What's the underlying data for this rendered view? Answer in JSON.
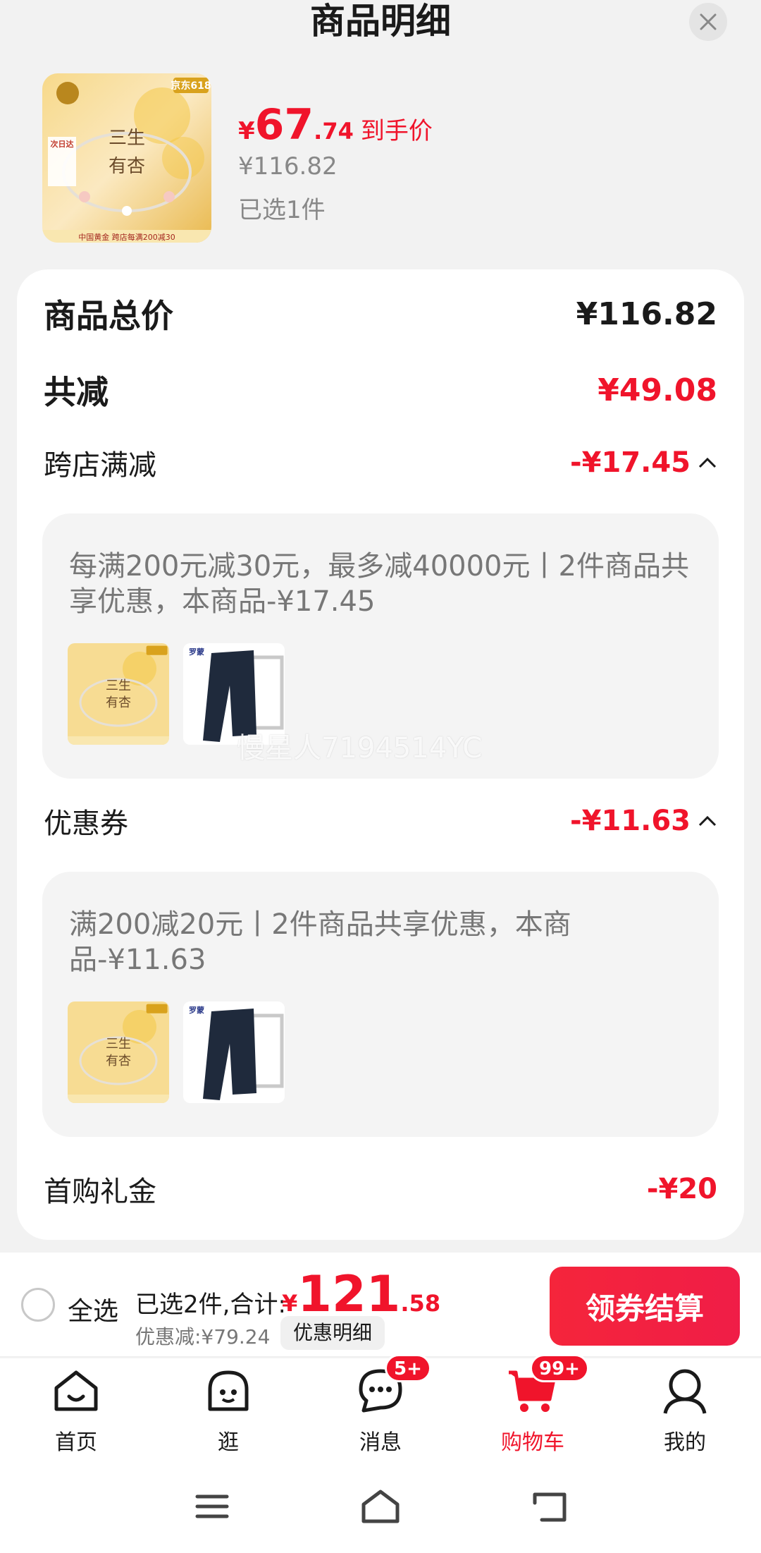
{
  "header": {
    "title": "商品明细"
  },
  "product": {
    "price_yen": "¥",
    "price_int": "67",
    "price_dec": ".74",
    "price_tag": "到手价",
    "original_price": "¥116.82",
    "selected": "已选1件",
    "thumb_text": {
      "brand": "京东618",
      "line1": "三生",
      "line2": "有杏",
      "footer": "中国黄金 跨店每满200减30",
      "tag": "次日达"
    }
  },
  "summary": {
    "total_label": "商品总价",
    "total_value": "¥116.82",
    "reduce_label": "共减",
    "reduce_value": "¥49.08"
  },
  "promotions": [
    {
      "label": "跨店满减",
      "amount": "-¥17.45",
      "detail": "每满200元减30元，最多减40000元丨2件商品共享优惠，本商品-¥17.45"
    },
    {
      "label": "优惠券",
      "amount": "-¥11.63",
      "detail": "满200减20元丨2件商品共享优惠，本商品-¥11.63"
    }
  ],
  "gift": {
    "label": "首购礼金",
    "amount": "-¥20"
  },
  "watermark": "慢星人7194514YC",
  "second_thumb_brand": "罗蒙",
  "checkout": {
    "select_all": "全选",
    "summary_text": "已选2件,合计:",
    "total_yen": "¥",
    "total_int": "121",
    "total_dec": ".58",
    "discount": "优惠减:¥79.24",
    "detail_chip": "优惠明细",
    "pay_button": "领券结算"
  },
  "tabs": [
    {
      "label": "首页",
      "icon": "home-icon"
    },
    {
      "label": "逛",
      "icon": "face-icon"
    },
    {
      "label": "消息",
      "icon": "chat-icon",
      "badge": "5+"
    },
    {
      "label": "购物车",
      "icon": "cart-icon",
      "badge": "99+",
      "active": true
    },
    {
      "label": "我的",
      "icon": "user-icon"
    }
  ],
  "colors": {
    "accent": "#f0142b",
    "card": "#ffffff",
    "background": "#f2f2f2"
  }
}
